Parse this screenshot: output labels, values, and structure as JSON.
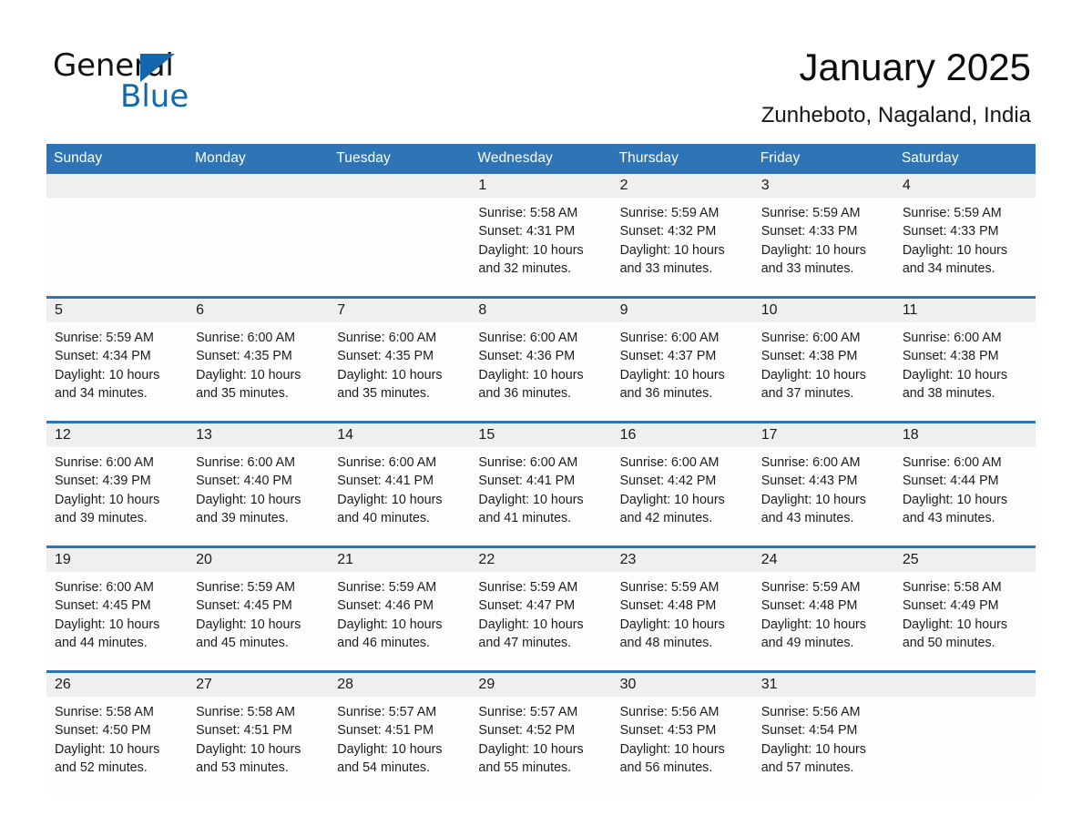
{
  "logo": {
    "word_one": "General",
    "word_two": "Blue",
    "triangle_color": "#1267ad",
    "icon": "triangle-icon"
  },
  "header": {
    "title": "January 2025",
    "location": "Zunheboto, Nagaland, India",
    "accent_color": "#2f74b5",
    "daynum_band_color": "#efefef"
  },
  "weekday_headers": [
    "Sunday",
    "Monday",
    "Tuesday",
    "Wednesday",
    "Thursday",
    "Friday",
    "Saturday"
  ],
  "weeks": [
    [
      {
        "day": "",
        "blank": true
      },
      {
        "day": "",
        "blank": true
      },
      {
        "day": "",
        "blank": true
      },
      {
        "day": "1",
        "sunrise": "Sunrise: 5:58 AM",
        "sunset": "Sunset: 4:31 PM",
        "daylight_1": "Daylight: 10 hours",
        "daylight_2": "and 32 minutes."
      },
      {
        "day": "2",
        "sunrise": "Sunrise: 5:59 AM",
        "sunset": "Sunset: 4:32 PM",
        "daylight_1": "Daylight: 10 hours",
        "daylight_2": "and 33 minutes."
      },
      {
        "day": "3",
        "sunrise": "Sunrise: 5:59 AM",
        "sunset": "Sunset: 4:33 PM",
        "daylight_1": "Daylight: 10 hours",
        "daylight_2": "and 33 minutes."
      },
      {
        "day": "4",
        "sunrise": "Sunrise: 5:59 AM",
        "sunset": "Sunset: 4:33 PM",
        "daylight_1": "Daylight: 10 hours",
        "daylight_2": "and 34 minutes."
      }
    ],
    [
      {
        "day": "5",
        "sunrise": "Sunrise: 5:59 AM",
        "sunset": "Sunset: 4:34 PM",
        "daylight_1": "Daylight: 10 hours",
        "daylight_2": "and 34 minutes."
      },
      {
        "day": "6",
        "sunrise": "Sunrise: 6:00 AM",
        "sunset": "Sunset: 4:35 PM",
        "daylight_1": "Daylight: 10 hours",
        "daylight_2": "and 35 minutes."
      },
      {
        "day": "7",
        "sunrise": "Sunrise: 6:00 AM",
        "sunset": "Sunset: 4:35 PM",
        "daylight_1": "Daylight: 10 hours",
        "daylight_2": "and 35 minutes."
      },
      {
        "day": "8",
        "sunrise": "Sunrise: 6:00 AM",
        "sunset": "Sunset: 4:36 PM",
        "daylight_1": "Daylight: 10 hours",
        "daylight_2": "and 36 minutes."
      },
      {
        "day": "9",
        "sunrise": "Sunrise: 6:00 AM",
        "sunset": "Sunset: 4:37 PM",
        "daylight_1": "Daylight: 10 hours",
        "daylight_2": "and 36 minutes."
      },
      {
        "day": "10",
        "sunrise": "Sunrise: 6:00 AM",
        "sunset": "Sunset: 4:38 PM",
        "daylight_1": "Daylight: 10 hours",
        "daylight_2": "and 37 minutes."
      },
      {
        "day": "11",
        "sunrise": "Sunrise: 6:00 AM",
        "sunset": "Sunset: 4:38 PM",
        "daylight_1": "Daylight: 10 hours",
        "daylight_2": "and 38 minutes."
      }
    ],
    [
      {
        "day": "12",
        "sunrise": "Sunrise: 6:00 AM",
        "sunset": "Sunset: 4:39 PM",
        "daylight_1": "Daylight: 10 hours",
        "daylight_2": "and 39 minutes."
      },
      {
        "day": "13",
        "sunrise": "Sunrise: 6:00 AM",
        "sunset": "Sunset: 4:40 PM",
        "daylight_1": "Daylight: 10 hours",
        "daylight_2": "and 39 minutes."
      },
      {
        "day": "14",
        "sunrise": "Sunrise: 6:00 AM",
        "sunset": "Sunset: 4:41 PM",
        "daylight_1": "Daylight: 10 hours",
        "daylight_2": "and 40 minutes."
      },
      {
        "day": "15",
        "sunrise": "Sunrise: 6:00 AM",
        "sunset": "Sunset: 4:41 PM",
        "daylight_1": "Daylight: 10 hours",
        "daylight_2": "and 41 minutes."
      },
      {
        "day": "16",
        "sunrise": "Sunrise: 6:00 AM",
        "sunset": "Sunset: 4:42 PM",
        "daylight_1": "Daylight: 10 hours",
        "daylight_2": "and 42 minutes."
      },
      {
        "day": "17",
        "sunrise": "Sunrise: 6:00 AM",
        "sunset": "Sunset: 4:43 PM",
        "daylight_1": "Daylight: 10 hours",
        "daylight_2": "and 43 minutes."
      },
      {
        "day": "18",
        "sunrise": "Sunrise: 6:00 AM",
        "sunset": "Sunset: 4:44 PM",
        "daylight_1": "Daylight: 10 hours",
        "daylight_2": "and 43 minutes."
      }
    ],
    [
      {
        "day": "19",
        "sunrise": "Sunrise: 6:00 AM",
        "sunset": "Sunset: 4:45 PM",
        "daylight_1": "Daylight: 10 hours",
        "daylight_2": "and 44 minutes."
      },
      {
        "day": "20",
        "sunrise": "Sunrise: 5:59 AM",
        "sunset": "Sunset: 4:45 PM",
        "daylight_1": "Daylight: 10 hours",
        "daylight_2": "and 45 minutes."
      },
      {
        "day": "21",
        "sunrise": "Sunrise: 5:59 AM",
        "sunset": "Sunset: 4:46 PM",
        "daylight_1": "Daylight: 10 hours",
        "daylight_2": "and 46 minutes."
      },
      {
        "day": "22",
        "sunrise": "Sunrise: 5:59 AM",
        "sunset": "Sunset: 4:47 PM",
        "daylight_1": "Daylight: 10 hours",
        "daylight_2": "and 47 minutes."
      },
      {
        "day": "23",
        "sunrise": "Sunrise: 5:59 AM",
        "sunset": "Sunset: 4:48 PM",
        "daylight_1": "Daylight: 10 hours",
        "daylight_2": "and 48 minutes."
      },
      {
        "day": "24",
        "sunrise": "Sunrise: 5:59 AM",
        "sunset": "Sunset: 4:48 PM",
        "daylight_1": "Daylight: 10 hours",
        "daylight_2": "and 49 minutes."
      },
      {
        "day": "25",
        "sunrise": "Sunrise: 5:58 AM",
        "sunset": "Sunset: 4:49 PM",
        "daylight_1": "Daylight: 10 hours",
        "daylight_2": "and 50 minutes."
      }
    ],
    [
      {
        "day": "26",
        "sunrise": "Sunrise: 5:58 AM",
        "sunset": "Sunset: 4:50 PM",
        "daylight_1": "Daylight: 10 hours",
        "daylight_2": "and 52 minutes."
      },
      {
        "day": "27",
        "sunrise": "Sunrise: 5:58 AM",
        "sunset": "Sunset: 4:51 PM",
        "daylight_1": "Daylight: 10 hours",
        "daylight_2": "and 53 minutes."
      },
      {
        "day": "28",
        "sunrise": "Sunrise: 5:57 AM",
        "sunset": "Sunset: 4:51 PM",
        "daylight_1": "Daylight: 10 hours",
        "daylight_2": "and 54 minutes."
      },
      {
        "day": "29",
        "sunrise": "Sunrise: 5:57 AM",
        "sunset": "Sunset: 4:52 PM",
        "daylight_1": "Daylight: 10 hours",
        "daylight_2": "and 55 minutes."
      },
      {
        "day": "30",
        "sunrise": "Sunrise: 5:56 AM",
        "sunset": "Sunset: 4:53 PM",
        "daylight_1": "Daylight: 10 hours",
        "daylight_2": "and 56 minutes."
      },
      {
        "day": "31",
        "sunrise": "Sunrise: 5:56 AM",
        "sunset": "Sunset: 4:54 PM",
        "daylight_1": "Daylight: 10 hours",
        "daylight_2": "and 57 minutes."
      },
      {
        "day": "",
        "blank": true
      }
    ]
  ]
}
